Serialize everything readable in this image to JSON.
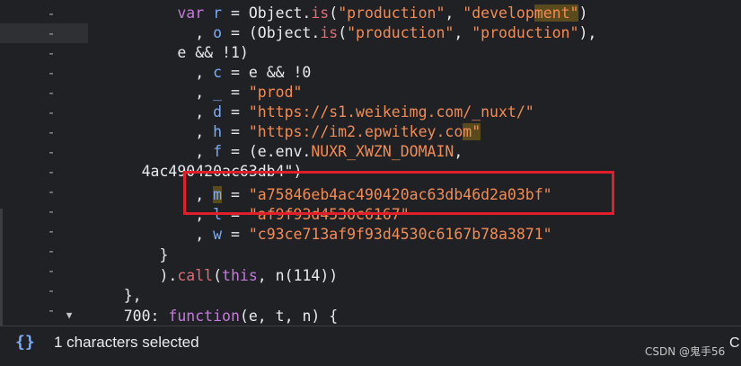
{
  "gutter": {
    "markers": [
      "-",
      "-",
      "-",
      "-",
      "-",
      "-",
      "-",
      "-",
      "-",
      "-",
      "-",
      "-",
      "-",
      "-",
      "-",
      "-"
    ],
    "fold_arrow": "▼"
  },
  "code": {
    "l1": {
      "indent": "          ",
      "kw": "var",
      "sp1": " ",
      "v": "r",
      "t1": " = Object.",
      "fn": "is",
      "t2": "(",
      "s1": "\"production\"",
      "t3": ", ",
      "s2a": "\"develop",
      "s2b": "ment\"",
      "t4": ")"
    },
    "l2": {
      "indent": "            ",
      "t1": ", ",
      "v": "o",
      "t2": " = (Object.",
      "fn": "is",
      "t3": "(",
      "s1": "\"production\"",
      "t4": ", ",
      "s2": "\"production\"",
      "t5": "),"
    },
    "l3": {
      "indent": "          ",
      "t1": "e && !1)"
    },
    "l4": {
      "indent": "            ",
      "t1": ", ",
      "v": "c",
      "t2": " = e && !0"
    },
    "l5": {
      "indent": "            ",
      "t1": ", ",
      "v": "_",
      "t2": " = ",
      "s": "\"prod\""
    },
    "l6": {
      "indent": "            ",
      "t1": ", ",
      "v": "d",
      "t2": " = ",
      "s": "\"https://s1.weikeimg.com/_nuxt/\""
    },
    "l7": {
      "indent": "            ",
      "t1": ", ",
      "v": "h",
      "t2": " = ",
      "s1": "\"https://im2.epwitkey.co",
      "s2": "m\""
    },
    "l8": {
      "indent": "            ",
      "t1": ", ",
      "v": "f",
      "t2": " = (e.env.",
      "s": "NUXR_XWZN_DOMAIN",
      "t3": ","
    },
    "l9": {
      "indent": "      ",
      "t1": "4ac490420ac63db4\")"
    },
    "l10": {
      "indent": "            ",
      "t1": ", ",
      "v": "m",
      "t2": " = ",
      "s": "\"a75846eb4ac490420ac63db46d2a03bf\""
    },
    "l11": {
      "indent": "            ",
      "t1": ", ",
      "v": "l",
      "t2": " = ",
      "s": "\"af9f93d4530c6167\""
    },
    "l12": {
      "indent": "            ",
      "t1": ", ",
      "v": "w",
      "t2": " = ",
      "s": "\"c93ce713af9f93d4530c6167b78a3871\""
    },
    "l13": {
      "indent": "        ",
      "t1": "}"
    },
    "l14": {
      "indent": "        ",
      "t1": ").",
      "fn": "call",
      "t2": "(",
      "kw": "this",
      "t3": ", n(",
      "n": "114",
      "t4": "))"
    },
    "l15": {
      "indent": "    ",
      "t1": "},"
    },
    "l16": {
      "indent": "    ",
      "t1": "700: ",
      "kw": "function",
      "t2": "(e, t, n) {"
    }
  },
  "status": {
    "icon": "{}",
    "text": "1 characters selected",
    "watermark": "CSDN @鬼手56",
    "cut_letter": "C"
  }
}
